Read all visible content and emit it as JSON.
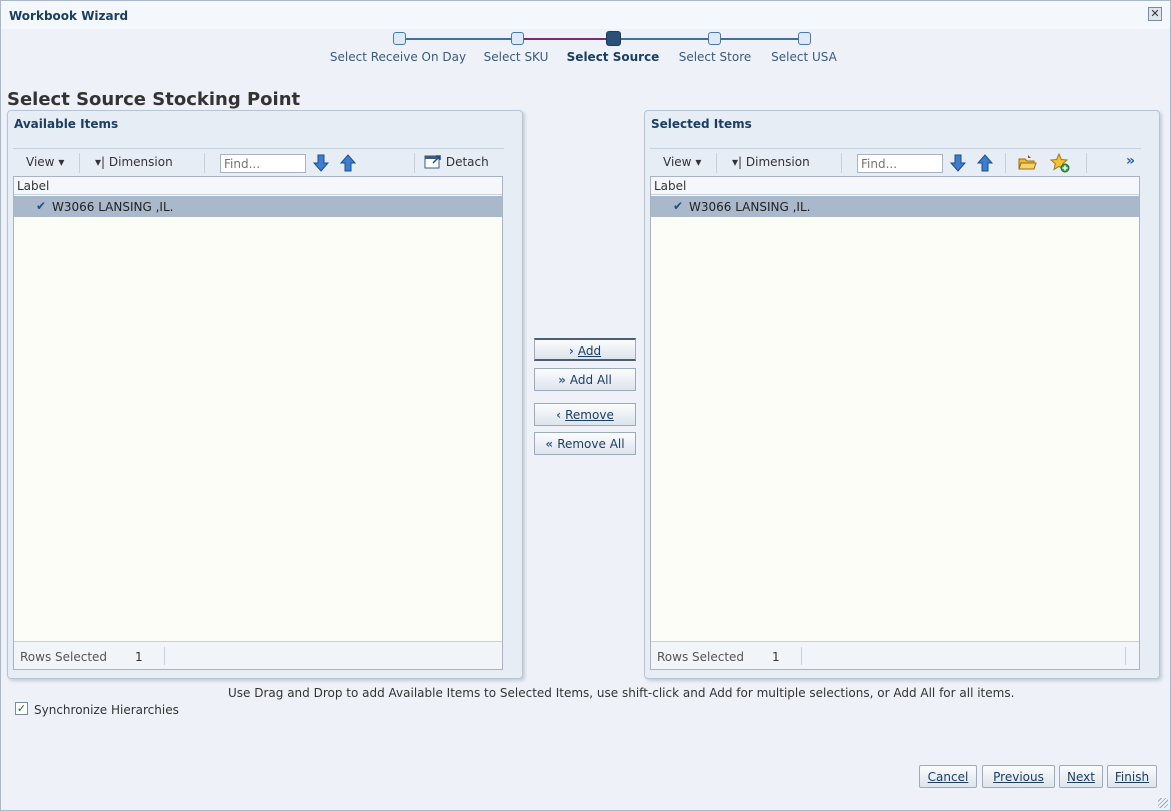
{
  "window": {
    "title": "Workbook Wizard",
    "close_icon": "close-icon"
  },
  "train": {
    "stops": [
      {
        "label": "Select Receive On Day",
        "state": "visited"
      },
      {
        "label": "Select SKU",
        "state": "visited"
      },
      {
        "label": "Select Source",
        "state": "current"
      },
      {
        "label": "Select Store",
        "state": "unvisited"
      },
      {
        "label": "Select USA",
        "state": "unvisited"
      }
    ]
  },
  "page": {
    "heading": "Select Source Stocking Point"
  },
  "available": {
    "title": "Available Items",
    "view_label": "View",
    "dimension_label": "Dimension",
    "find_placeholder": "Find...",
    "detach_label": "Detach",
    "column_label": "Label",
    "rows": [
      {
        "text": "W3066 LANSING ,IL.",
        "selected": true
      }
    ],
    "status_label": "Rows Selected",
    "status_value": "1"
  },
  "selected": {
    "title": "Selected Items",
    "view_label": "View",
    "dimension_label": "Dimension",
    "find_placeholder": "Find...",
    "overflow_label": "»",
    "column_label": "Label",
    "rows": [
      {
        "text": "W3066 LANSING ,IL.",
        "selected": true
      }
    ],
    "status_label": "Rows Selected",
    "status_value": "1"
  },
  "shuttle": {
    "add": "Add",
    "add_all": "Add All",
    "remove": "Remove",
    "remove_all": "Remove All"
  },
  "help_text": "Use Drag and Drop to add Available Items to Selected Items, use shift-click and Add for multiple selections, or Add All for all items.",
  "sync": {
    "label": "Synchronize Hierarchies",
    "checked": true
  },
  "footer": {
    "cancel": "Cancel",
    "previous": "Previous",
    "next": "Next",
    "finish": "Finish"
  },
  "colors": {
    "accent": "#1b3e63",
    "selected_row": "#a9b8cb",
    "panel_bg": "#e6edf5",
    "train_visited": "#7a2c6e"
  }
}
